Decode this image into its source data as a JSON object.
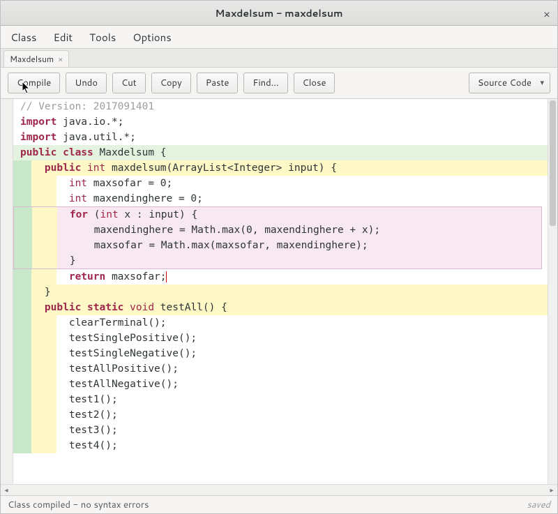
{
  "window": {
    "title": "Maxdelsum - maxdelsum"
  },
  "menubar": {
    "items": [
      "Class",
      "Edit",
      "Tools",
      "Options"
    ]
  },
  "tab": {
    "label": "Maxdelsum"
  },
  "toolbar": {
    "compile": "Compile",
    "undo": "Undo",
    "cut": "Cut",
    "copy": "Copy",
    "paste": "Paste",
    "find": "Find...",
    "close": "Close",
    "viewmode": "Source Code"
  },
  "status": {
    "left": "Class compiled - no syntax errors",
    "right": "saved"
  },
  "code": {
    "l1": "// Version: 2017091401",
    "l2a": "import",
    "l2b": " java.io.*;",
    "l3a": "import",
    "l3b": " java.util.*;",
    "l4a": "public ",
    "l4b": "class",
    "l4c": " Maxdelsum {",
    "l5a": "    public ",
    "l5b": "int",
    "l5c": " maxdelsum(ArrayList<Integer> input) {",
    "l6a": "        int",
    "l6b": " maxsofar = 0;",
    "l7a": "        int",
    "l7b": " maxendinghere = 0;",
    "l8a": "        for",
    "l8b": " (",
    "l8c": "int",
    "l8d": " x : input) {",
    "l9": "            maxendinghere = Math.max(0, maxendinghere + x);",
    "l10": "            maxsofar = Math.max(maxsofar, maxendinghere);",
    "l11": "        }",
    "l12a": "        return",
    "l12b": " maxsofar;",
    "l13": "    }",
    "l14": "",
    "l15a": "    public ",
    "l15b": "static ",
    "l15c": "void",
    "l15d": " testAll() {",
    "l16": "        clearTerminal();",
    "l17": "        testSinglePositive();",
    "l18": "        testSingleNegative();",
    "l19": "        testAllPositive();",
    "l20": "        testAllNegative();",
    "l21": "        test1();",
    "l22": "        test2();",
    "l23": "        test3();",
    "l24": "        test4();"
  }
}
